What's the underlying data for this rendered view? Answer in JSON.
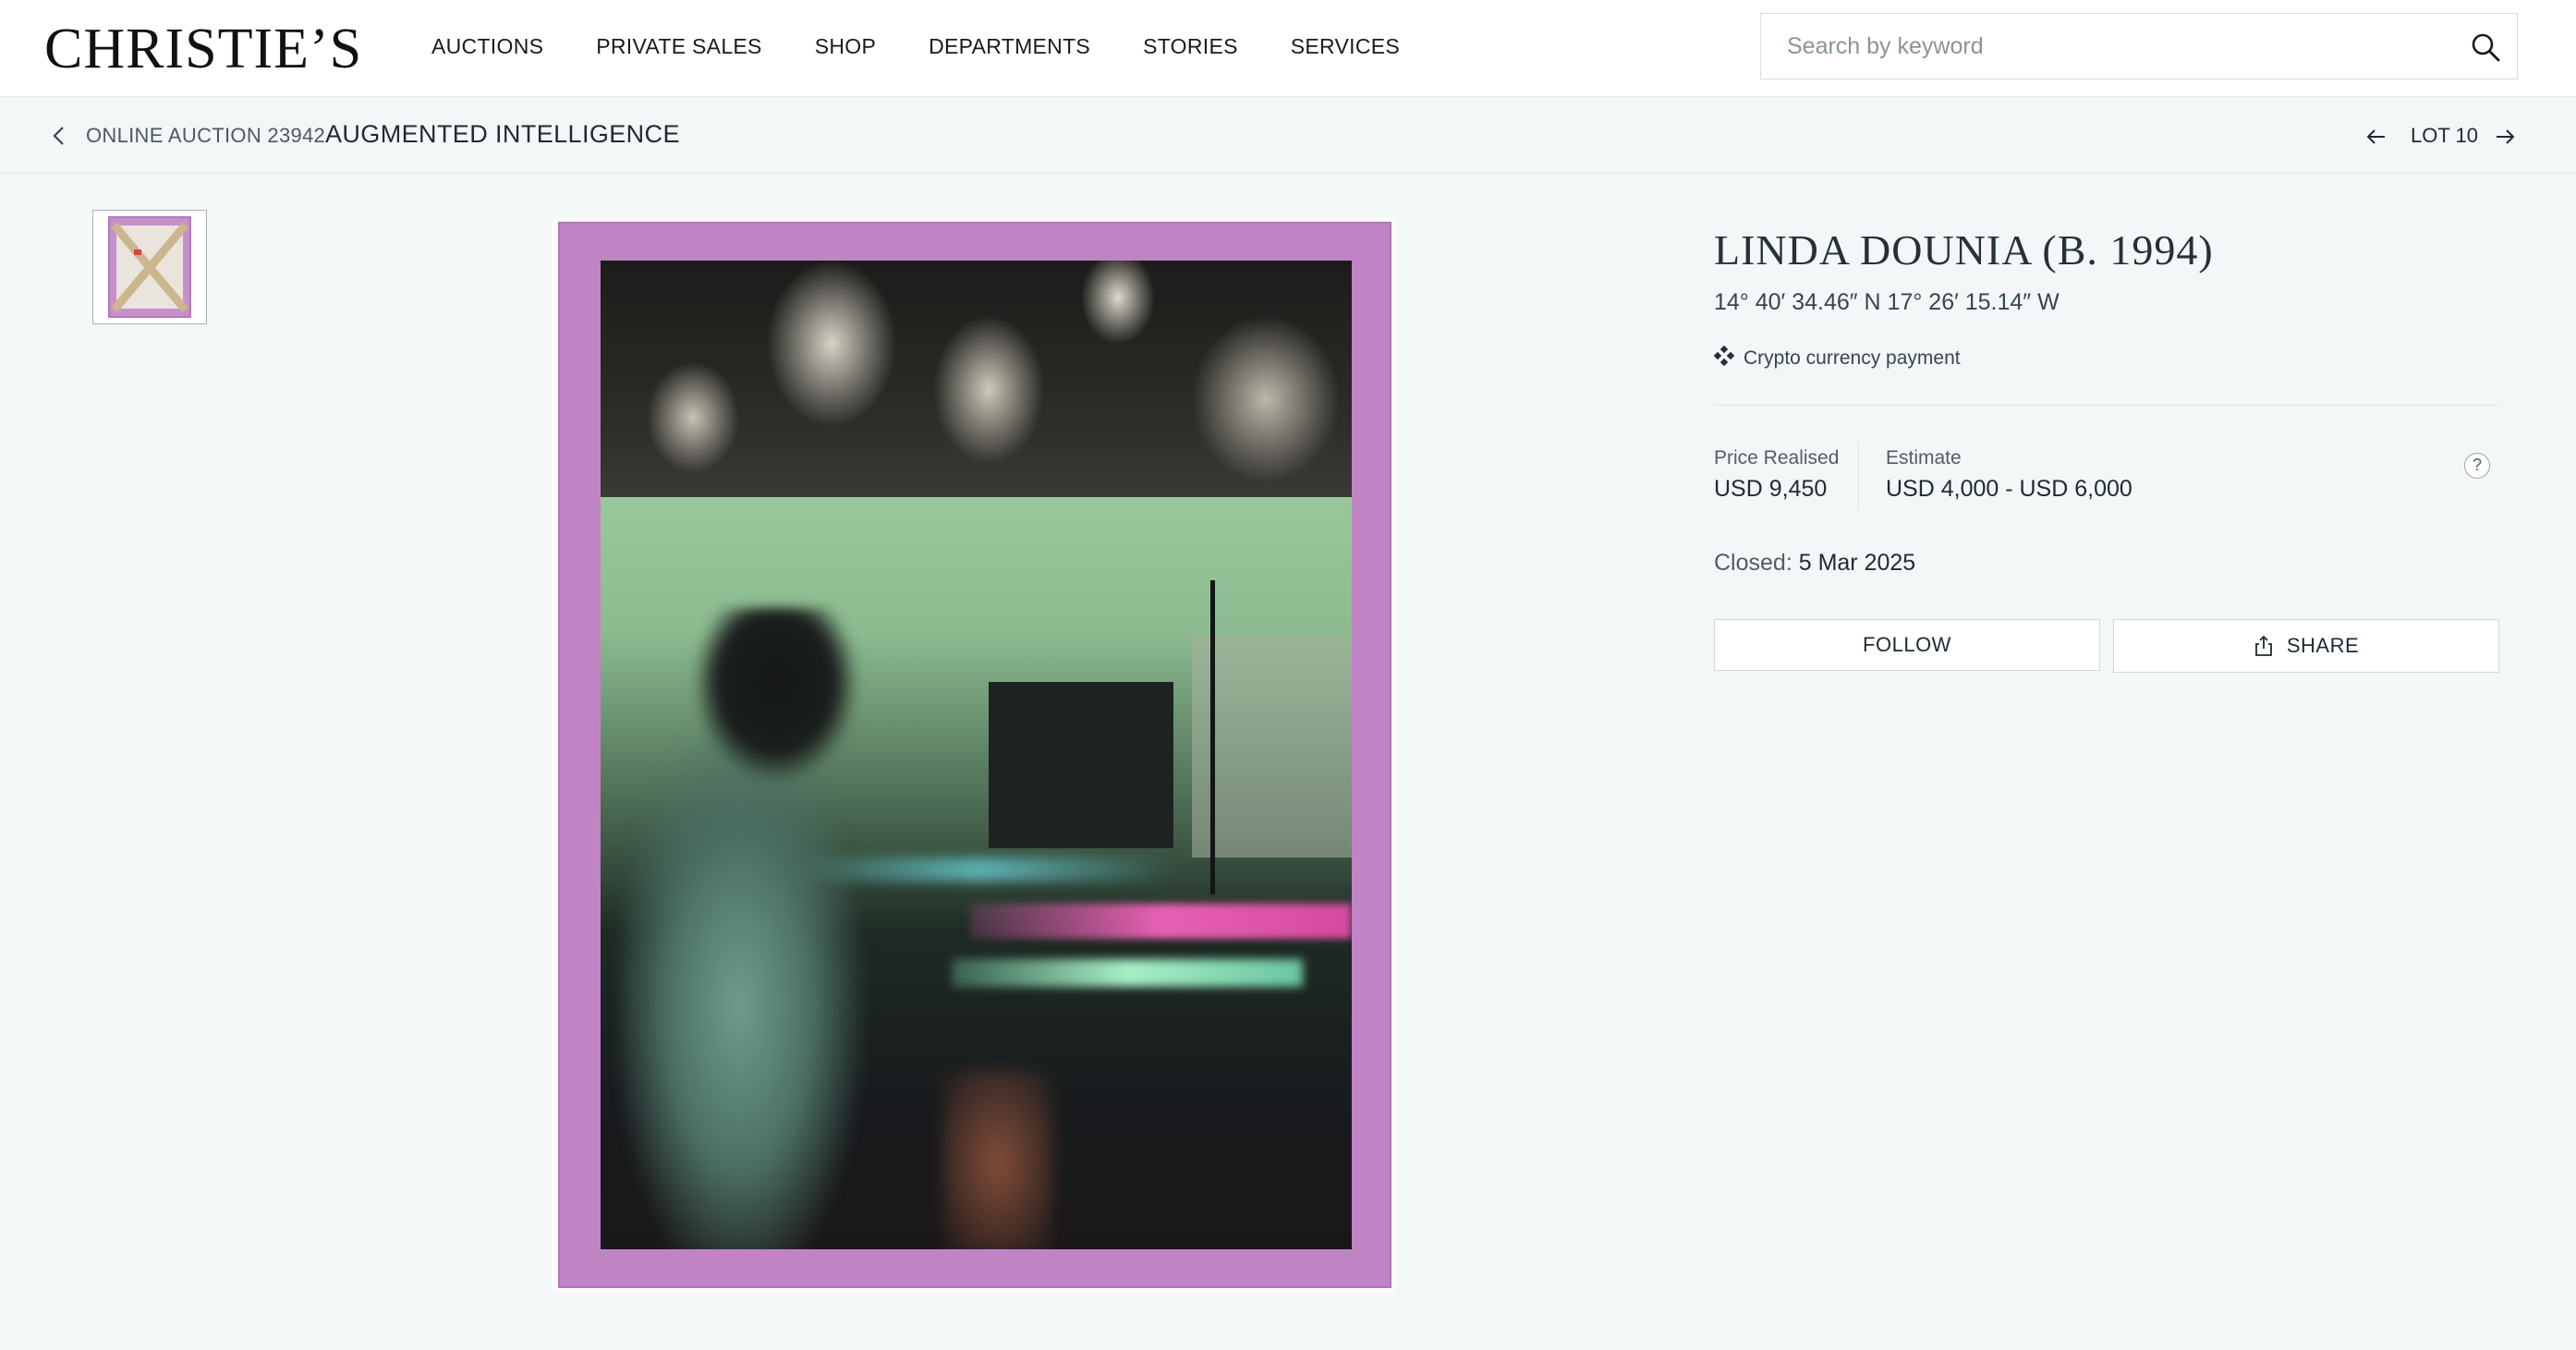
{
  "header": {
    "logo": "CHRISTIE’S",
    "nav": [
      "AUCTIONS",
      "PRIVATE SALES",
      "SHOP",
      "DEPARTMENTS",
      "STORIES",
      "SERVICES"
    ],
    "search_placeholder": "Search by keyword"
  },
  "breadcrumb": {
    "sale": "ONLINE AUCTION 23942",
    "title": "AUGMENTED INTELLIGENCE",
    "lot": "LOT 10"
  },
  "lot": {
    "artist": "LINDA DOUNIA (B. 1994)",
    "title": "14° 40′ 34.46″ N 17° 26′ 15.14″ W",
    "payment_note": "Crypto currency payment",
    "price_label": "Price Realised",
    "price_value": "USD 9,450",
    "estimate_label": "Estimate",
    "estimate_value": "USD 4,000 - USD 6,000",
    "closed_label": "Closed:",
    "closed_value": "5 Mar 2025",
    "help": "?"
  },
  "actions": {
    "follow": "FOLLOW",
    "share": "SHARE"
  },
  "icons": {
    "search": "search-icon",
    "back": "chevron-left-icon",
    "prev": "arrow-left-icon",
    "next": "arrow-right-icon",
    "crypto": "crypto-icon",
    "share": "share-icon"
  },
  "colors": {
    "page_background": "#f4f7f8",
    "mat_purple": "#c084c5",
    "text_dark": "#1e2b30"
  }
}
